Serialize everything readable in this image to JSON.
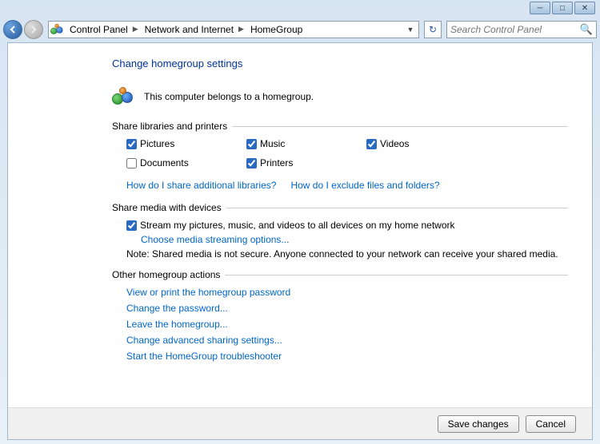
{
  "window": {
    "minimize": "—",
    "maximize": "❐",
    "close": "✕"
  },
  "breadcrumb": {
    "root": "Control Panel",
    "mid": "Network and Internet",
    "leaf": "HomeGroup"
  },
  "search": {
    "placeholder": "Search Control Panel"
  },
  "page": {
    "title": "Change homegroup settings",
    "status": "This computer belongs to a homegroup."
  },
  "sections": {
    "share_libs": "Share libraries and printers",
    "share_media": "Share media with devices",
    "other": "Other homegroup actions"
  },
  "checks": {
    "pictures": "Pictures",
    "music": "Music",
    "videos": "Videos",
    "documents": "Documents",
    "printers": "Printers",
    "stream": "Stream my pictures, music, and videos to all devices on my home network"
  },
  "links": {
    "share_additional": "How do I share additional libraries?",
    "exclude": "How do I exclude files and folders?",
    "media_options": "Choose media streaming options...",
    "view_password": "View or print the homegroup password",
    "change_password": "Change the password...",
    "leave": "Leave the homegroup...",
    "advanced": "Change advanced sharing settings...",
    "troubleshoot": "Start the HomeGroup troubleshooter"
  },
  "note": "Note: Shared media is not secure. Anyone connected to your network can receive your shared media.",
  "buttons": {
    "save": "Save changes",
    "cancel": "Cancel"
  }
}
